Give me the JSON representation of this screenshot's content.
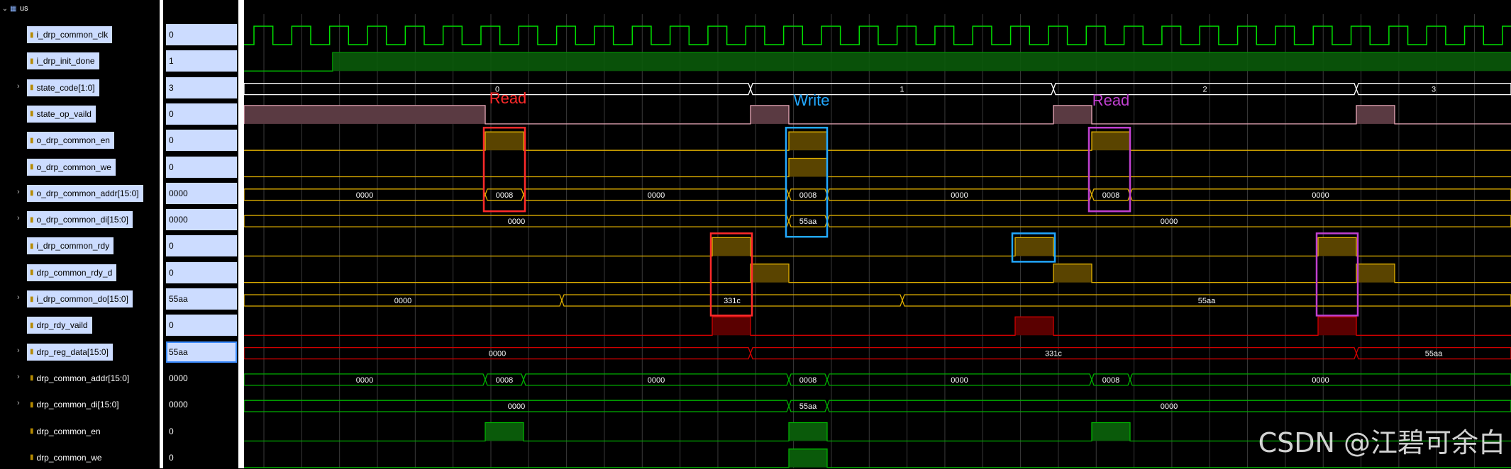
{
  "scope": {
    "name": "us"
  },
  "signals": [
    {
      "name": "i_drp_common_clk",
      "value": "0",
      "kind": "clk",
      "expand": false,
      "icon": "input"
    },
    {
      "name": "i_drp_init_done",
      "value": "1",
      "kind": "bit",
      "expand": false,
      "icon": "input"
    },
    {
      "name": "state_code[1:0]",
      "value": "3",
      "kind": "bus",
      "expand": true,
      "icon": "reg"
    },
    {
      "name": "state_op_vaild",
      "value": "0",
      "kind": "bit",
      "expand": false,
      "icon": "reg"
    },
    {
      "name": "o_drp_common_en",
      "value": "0",
      "kind": "bit",
      "expand": false,
      "icon": "output"
    },
    {
      "name": "o_drp_common_we",
      "value": "0",
      "kind": "bit",
      "expand": false,
      "icon": "output"
    },
    {
      "name": "o_drp_common_addr[15:0]",
      "value": "0000",
      "kind": "bus",
      "expand": true,
      "icon": "output"
    },
    {
      "name": "o_drp_common_di[15:0]",
      "value": "0000",
      "kind": "bus",
      "expand": true,
      "icon": "output"
    },
    {
      "name": "i_drp_common_rdy",
      "value": "0",
      "kind": "bit",
      "expand": false,
      "icon": "input"
    },
    {
      "name": "drp_common_rdy_d",
      "value": "0",
      "kind": "bit",
      "expand": false,
      "icon": "reg"
    },
    {
      "name": "i_drp_common_do[15:0]",
      "value": "55aa",
      "kind": "bus",
      "expand": true,
      "icon": "input"
    },
    {
      "name": "drp_rdy_vaild",
      "value": "0",
      "kind": "bit",
      "expand": false,
      "icon": "reg"
    },
    {
      "name": "drp_reg_data[15:0]",
      "value": "55aa",
      "kind": "bus",
      "expand": true,
      "icon": "reg"
    },
    {
      "name": "drp_common_addr[15:0]",
      "value": "0000",
      "kind": "bus",
      "expand": true,
      "icon": "reg"
    },
    {
      "name": "drp_common_di[15:0]",
      "value": "0000",
      "kind": "bus",
      "expand": true,
      "icon": "reg"
    },
    {
      "name": "drp_common_en",
      "value": "0",
      "kind": "bit",
      "expand": false,
      "icon": "reg"
    },
    {
      "name": "drp_common_we",
      "value": "0",
      "kind": "bit",
      "expand": false,
      "icon": "reg"
    }
  ],
  "bus_labels": {
    "state_code": [
      "0",
      "1",
      "2",
      "3"
    ],
    "o_drp_common_addr": [
      "0000",
      "0008",
      "0000",
      "0008",
      "0000",
      "0008",
      "0000"
    ],
    "o_drp_common_di": [
      "0000",
      "55aa",
      "0000"
    ],
    "i_drp_common_do": [
      "0000",
      "331c",
      "55aa"
    ],
    "drp_reg_data": [
      "0000",
      "331c",
      "55aa"
    ],
    "drp_common_addr": [
      "0000",
      "0008",
      "0000",
      "0008",
      "0000",
      "0008",
      "0000"
    ],
    "drp_common_di": [
      "0000",
      "55aa",
      "0000"
    ]
  },
  "annotations": [
    {
      "text": "Read",
      "color": "#ff2a2a"
    },
    {
      "text": "Write",
      "color": "#22a8ff"
    },
    {
      "text": "Read",
      "color": "#c040d0"
    }
  ],
  "colors": {
    "clk": "#00e000",
    "bit_green": "#00b000",
    "bus_white": "#ffffff",
    "yellow": "#e0b000",
    "red": "#d00000",
    "pink": "#e8a8b8",
    "blue": "#22a8ff",
    "purple": "#c040d0"
  },
  "watermark": "CSDN @江碧可余白"
}
